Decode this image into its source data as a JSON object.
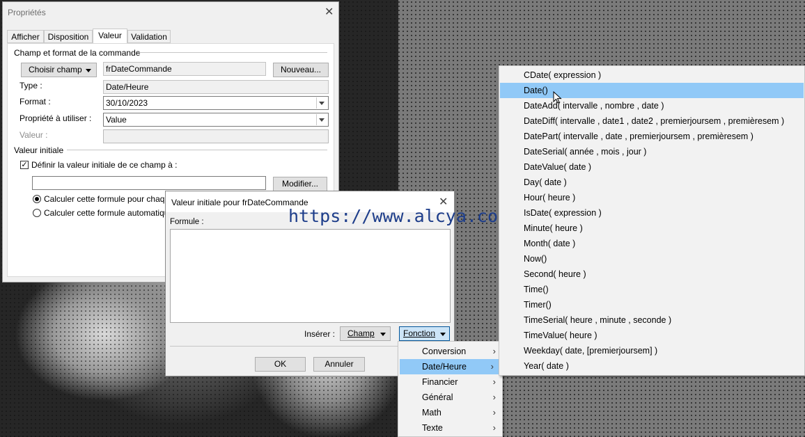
{
  "properties_dialog": {
    "title": "Propriétés",
    "tabs": [
      "Afficher",
      "Disposition",
      "Valeur",
      "Validation"
    ],
    "active_tab": "Valeur",
    "section_command": "Champ et format de la commande",
    "choose_field_button": "Choisir champ",
    "field_name": "frDateCommande",
    "new_button": "Nouveau...",
    "type_label": "Type :",
    "type_value": "Date/Heure",
    "format_label": "Format :",
    "format_value": "30/10/2023",
    "property_label": "Propriété à utiliser :",
    "property_value": "Value",
    "value_label": "Valeur :",
    "value_value": "",
    "section_initial": "Valeur initiale",
    "define_initial_checkbox": "Définir la valeur initiale de ce champ à :",
    "initial_value": "",
    "modify_button": "Modifier...",
    "radio_each": "Calculer cette formule pour chaqu",
    "radio_auto": "Calculer cette formule automatiqu"
  },
  "formula_dialog": {
    "title": "Valeur initiale pour frDateCommande",
    "formula_label": "Formule :",
    "formula_value": "",
    "insert_label": "Insérer :",
    "field_button": "Champ",
    "function_button": "Fonction",
    "ok_button": "OK",
    "cancel_button": "Annuler"
  },
  "category_menu": {
    "items": [
      "Conversion",
      "Date/Heure",
      "Financier",
      "Général",
      "Math",
      "Texte"
    ],
    "selected": "Date/Heure"
  },
  "function_menu": {
    "items": [
      "CDate( expression )",
      "Date()",
      "DateAdd( intervalle , nombre , date )",
      "DateDiff( intervalle , date1 , date2 , premierjoursem , premièresem )",
      "DatePart( intervalle , date , premierjoursem , premièresem )",
      "DateSerial( année , mois , jour )",
      "DateValue( date )",
      "Day( date )",
      "Hour( heure )",
      "IsDate( expression )",
      "Minute( heure )",
      "Month( date )",
      "Now()",
      "Second( heure )",
      "Time()",
      "Timer()",
      "TimeSerial( heure , minute , seconde )",
      "TimeValue( heure )",
      "Weekday( date, [premierjoursem] )",
      "Year( date )"
    ],
    "selected": "Date()"
  },
  "watermark": "https://www.alcya.com",
  "colors": {
    "selection": "#91c9f7",
    "watermark": "#1d3d8a"
  }
}
